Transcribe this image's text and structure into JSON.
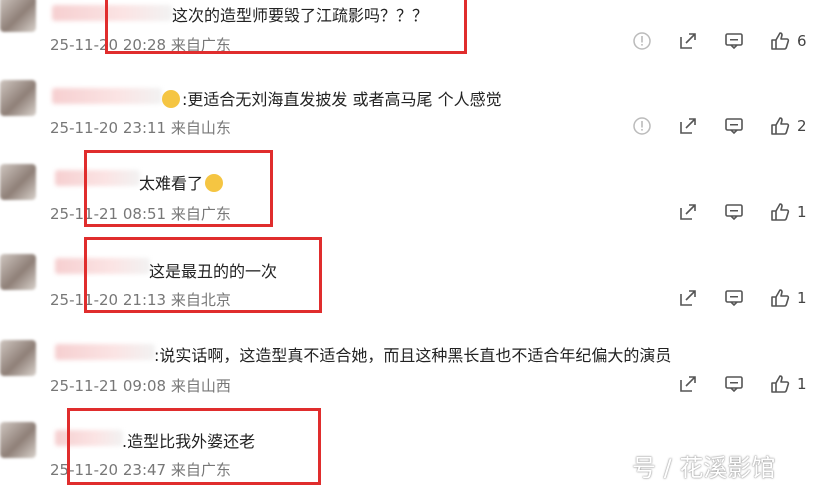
{
  "comments": [
    {
      "text": "这次的造型师要毁了江疏影吗？？？",
      "meta": "25-11-20 20:28 来自广东",
      "likes": "6",
      "has_report": true
    },
    {
      "text": ":更适合无刘海直发披发 或者高马尾 个人感觉",
      "meta": "25-11-20 23:11 来自山东",
      "likes": "2",
      "has_report": true
    },
    {
      "text": "太难看了",
      "meta": "25-11-21 08:51 来自广东",
      "likes": "1",
      "has_report": false
    },
    {
      "text": "这是最丑的的一次",
      "meta": "25-11-20 21:13 来自北京",
      "likes": "1",
      "has_report": false
    },
    {
      "text": ":说实话啊，这造型真不适合她，而且这种黑长直也不适合年纪偏大的演员",
      "meta": "25-11-21 09:08 来自山西",
      "likes": "1",
      "has_report": false
    },
    {
      "text": ".造型比我外婆还老",
      "meta": "25-11-20 23:47 来自广东",
      "likes": "",
      "has_report": false
    }
  ],
  "watermark": "号 / 花溪影馆",
  "icons": {
    "report": "report-icon",
    "share": "share-icon",
    "comment": "comment-icon",
    "like": "like-icon"
  },
  "colors": {
    "highlight": "#e02d2d",
    "meta": "#777777"
  }
}
